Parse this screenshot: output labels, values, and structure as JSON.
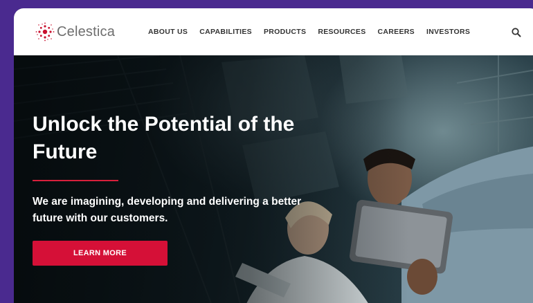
{
  "brand": {
    "name": "Celestica",
    "accent": "#d51037",
    "frame_bg": "#4a2a8f"
  },
  "nav": {
    "items": [
      "ABOUT US",
      "CAPABILITIES",
      "PRODUCTS",
      "RESOURCES",
      "CAREERS",
      "INVESTORS"
    ],
    "search_icon": "search-icon"
  },
  "hero": {
    "headline": "Unlock the Potential of the Future",
    "subline": "We are imagining, developing and delivering a better future with our customers.",
    "cta_label": "LEARN MORE"
  }
}
